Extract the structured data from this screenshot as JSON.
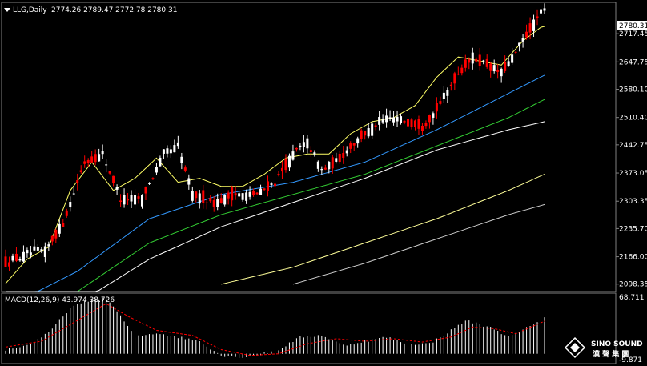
{
  "header": {
    "symbol": "LLG,Daily",
    "ohlc": "2774.26 2789.47 2772.78 2780.31"
  },
  "last_price_tag": "2780.31",
  "price_axis": {
    "ticks": [
      "2717.45",
      "2647.75",
      "2580.10",
      "2510.40",
      "2442.75",
      "2373.05",
      "2303.35",
      "2235.70",
      "2166.00",
      "2098.35"
    ],
    "tick_values": [
      2717.45,
      2647.75,
      2580.1,
      2510.4,
      2442.75,
      2373.05,
      2303.35,
      2235.7,
      2166.0,
      2098.35
    ]
  },
  "macd_panel": {
    "label": "MACD(12,26,9) 43.974 38.726",
    "max_label": "68.711",
    "min_label": "-9.871",
    "max_value": 68.711,
    "min_value": -9.871
  },
  "logo": {
    "name": "SINO SOUND",
    "subtitle": "漢 聲 集 團"
  },
  "colors": {
    "background": "#000000",
    "bull": "#ffffff",
    "bear": "#ff0000",
    "ma5": "#ffff66",
    "ma20": "#3399ff",
    "ma40": "#33cc33",
    "ma60": "#ffffff",
    "ma120": "#ffff99",
    "ma250": "#cccccc",
    "macd_hist": "#ffffff",
    "macd_signal": "#ff0000"
  },
  "chart_data": {
    "type": "candlestick",
    "title": "LLG,Daily",
    "ylim": [
      2080,
      2795
    ],
    "ma_guides": {
      "ma5": [
        [
          0,
          2100
        ],
        [
          6,
          2160
        ],
        [
          12,
          2190
        ],
        [
          18,
          2330
        ],
        [
          24,
          2400
        ],
        [
          30,
          2330
        ],
        [
          36,
          2360
        ],
        [
          42,
          2410
        ],
        [
          48,
          2350
        ],
        [
          54,
          2360
        ],
        [
          60,
          2340
        ],
        [
          66,
          2340
        ],
        [
          72,
          2370
        ],
        [
          78,
          2410
        ],
        [
          84,
          2420
        ],
        [
          90,
          2420
        ],
        [
          96,
          2470
        ],
        [
          102,
          2500
        ],
        [
          108,
          2510
        ],
        [
          114,
          2540
        ],
        [
          120,
          2610
        ],
        [
          126,
          2660
        ],
        [
          132,
          2650
        ],
        [
          138,
          2640
        ],
        [
          144,
          2700
        ],
        [
          150,
          2740
        ]
      ],
      "ma20": [
        [
          0,
          2040
        ],
        [
          20,
          2130
        ],
        [
          40,
          2260
        ],
        [
          60,
          2320
        ],
        [
          80,
          2350
        ],
        [
          100,
          2400
        ],
        [
          120,
          2480
        ],
        [
          140,
          2570
        ],
        [
          150,
          2615
        ]
      ],
      "ma40": [
        [
          0,
          1990
        ],
        [
          20,
          2080
        ],
        [
          40,
          2200
        ],
        [
          60,
          2270
        ],
        [
          80,
          2320
        ],
        [
          100,
          2370
        ],
        [
          120,
          2440
        ],
        [
          140,
          2510
        ],
        [
          150,
          2555
        ]
      ],
      "ma60": [
        [
          0,
          1960
        ],
        [
          20,
          2050
        ],
        [
          40,
          2160
        ],
        [
          60,
          2240
        ],
        [
          80,
          2300
        ],
        [
          100,
          2360
        ],
        [
          120,
          2430
        ],
        [
          140,
          2480
        ],
        [
          150,
          2500
        ]
      ],
      "ma120": [
        [
          60,
          2098
        ],
        [
          80,
          2140
        ],
        [
          100,
          2200
        ],
        [
          120,
          2260
        ],
        [
          140,
          2330
        ],
        [
          150,
          2370
        ]
      ],
      "ma250": [
        [
          80,
          2098
        ],
        [
          100,
          2150
        ],
        [
          120,
          2210
        ],
        [
          140,
          2270
        ],
        [
          150,
          2295
        ]
      ]
    },
    "candle_path": [
      [
        0,
        2150
      ],
      [
        8,
        2180
      ],
      [
        11,
        2180
      ],
      [
        16,
        2250
      ],
      [
        22,
        2400
      ],
      [
        27,
        2420
      ],
      [
        32,
        2310
      ],
      [
        38,
        2310
      ],
      [
        44,
        2420
      ],
      [
        48,
        2440
      ],
      [
        52,
        2320
      ],
      [
        58,
        2300
      ],
      [
        64,
        2320
      ],
      [
        70,
        2320
      ],
      [
        75,
        2350
      ],
      [
        80,
        2420
      ],
      [
        84,
        2450
      ],
      [
        88,
        2380
      ],
      [
        92,
        2400
      ],
      [
        96,
        2440
      ],
      [
        100,
        2470
      ],
      [
        104,
        2500
      ],
      [
        108,
        2510
      ],
      [
        112,
        2500
      ],
      [
        116,
        2490
      ],
      [
        120,
        2530
      ],
      [
        126,
        2620
      ],
      [
        130,
        2660
      ],
      [
        134,
        2640
      ],
      [
        138,
        2620
      ],
      [
        142,
        2670
      ],
      [
        146,
        2730
      ],
      [
        150,
        2780
      ]
    ],
    "macd_hist_path": [
      [
        0,
        5
      ],
      [
        6,
        10
      ],
      [
        12,
        25
      ],
      [
        18,
        55
      ],
      [
        24,
        65
      ],
      [
        28,
        68
      ],
      [
        32,
        45
      ],
      [
        36,
        20
      ],
      [
        42,
        25
      ],
      [
        48,
        20
      ],
      [
        54,
        15
      ],
      [
        60,
        -2
      ],
      [
        66,
        -4
      ],
      [
        70,
        -2
      ],
      [
        76,
        5
      ],
      [
        82,
        20
      ],
      [
        88,
        22
      ],
      [
        94,
        10
      ],
      [
        100,
        15
      ],
      [
        106,
        20
      ],
      [
        112,
        12
      ],
      [
        118,
        12
      ],
      [
        124,
        28
      ],
      [
        128,
        40
      ],
      [
        132,
        35
      ],
      [
        136,
        30
      ],
      [
        140,
        20
      ],
      [
        144,
        28
      ],
      [
        150,
        44
      ]
    ],
    "macd_signal_path": [
      [
        0,
        8
      ],
      [
        10,
        15
      ],
      [
        20,
        40
      ],
      [
        28,
        60
      ],
      [
        34,
        45
      ],
      [
        42,
        28
      ],
      [
        52,
        22
      ],
      [
        60,
        5
      ],
      [
        68,
        -2
      ],
      [
        76,
        0
      ],
      [
        84,
        12
      ],
      [
        92,
        18
      ],
      [
        100,
        15
      ],
      [
        108,
        18
      ],
      [
        116,
        14
      ],
      [
        124,
        20
      ],
      [
        130,
        32
      ],
      [
        136,
        30
      ],
      [
        142,
        24
      ],
      [
        150,
        39
      ]
    ]
  }
}
